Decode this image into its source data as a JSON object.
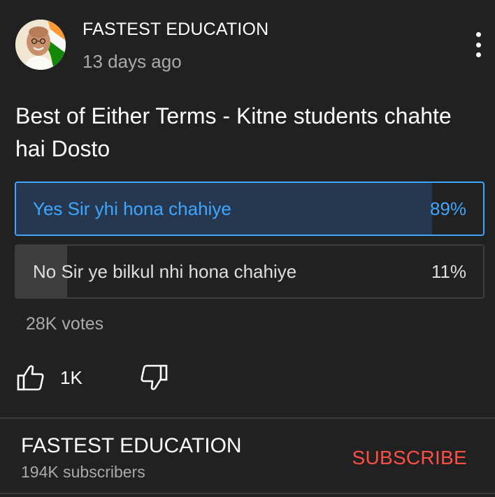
{
  "post": {
    "channel_name": "FASTEST EDUCATION",
    "time_ago": "13 days ago",
    "text": "Best of Either Terms - Kitne students chahte hai Dosto",
    "menu_icon": "more-vert-icon",
    "avatar": "channel-avatar"
  },
  "poll": {
    "options": [
      {
        "label": "Yes Sir yhi hona chahiye",
        "percent_label": "89%",
        "percent": 89,
        "selected": true
      },
      {
        "label": "No Sir ye bilkul nhi hona chahiye",
        "percent_label": "11%",
        "percent": 11,
        "selected": false
      }
    ],
    "votes": "28K votes"
  },
  "actions": {
    "like_icon": "thumbs-up-icon",
    "like_count": "1K",
    "dislike_icon": "thumbs-down-icon"
  },
  "footer": {
    "channel_name": "FASTEST EDUCATION",
    "subscribers": "194K subscribers",
    "subscribe_label": "SUBSCRIBE"
  },
  "colors": {
    "background": "#212121",
    "accent_blue": "#3ea6ff",
    "selected_fill": "#263850",
    "subscribe_red": "#ff4e45",
    "secondary_text": "#aaaaaa"
  }
}
